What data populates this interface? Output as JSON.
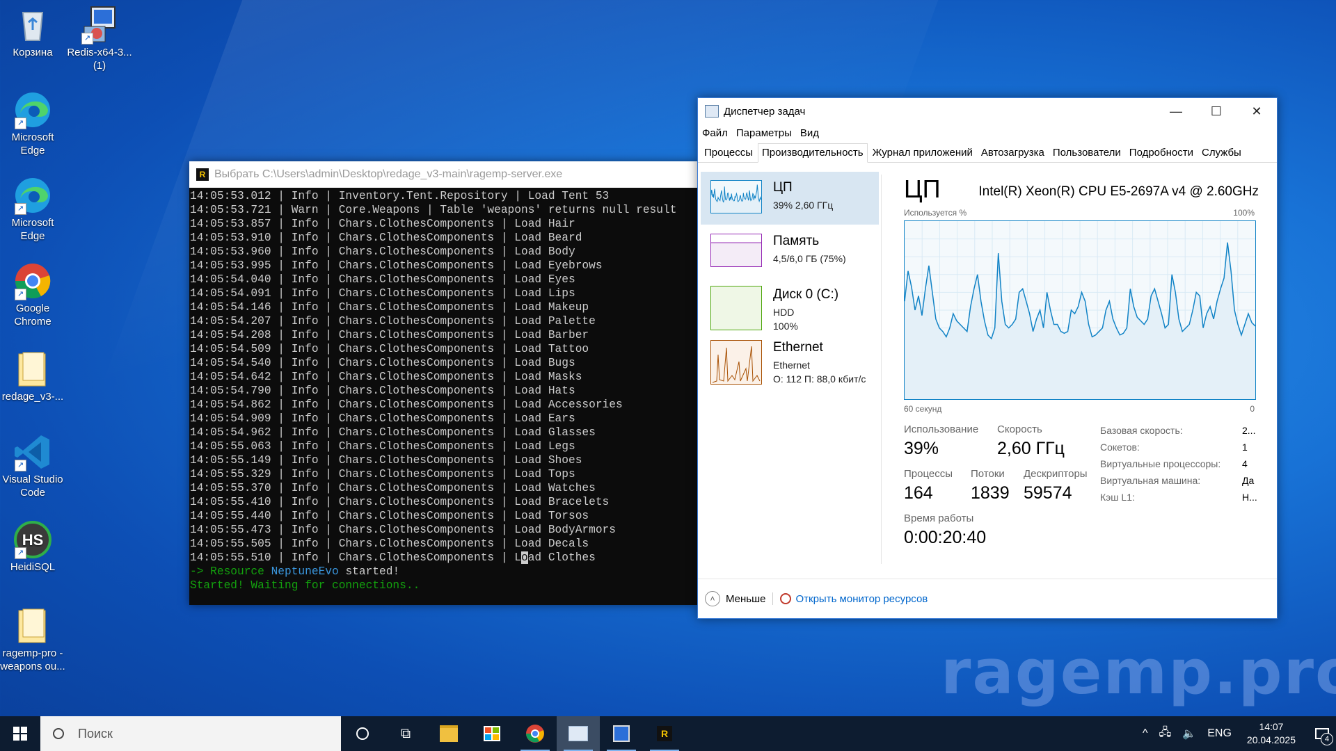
{
  "desktop": {
    "icons": [
      {
        "label": "Корзина"
      },
      {
        "label": "Redis-x64-3...(1)"
      },
      {
        "label": "Microsoft Edge"
      },
      {
        "label": "Microsoft Edge"
      },
      {
        "label": "Google Chrome"
      },
      {
        "label": "redage_v3-..."
      },
      {
        "label": "Visual Studio Code"
      },
      {
        "label": "HeidiSQL"
      },
      {
        "label": "ragemp-pro - weapons ou..."
      }
    ],
    "watermark": "ragemp.pro"
  },
  "console": {
    "title": "Выбрать C:\\Users\\admin\\Desktop\\redage_v3-main\\ragemp-server.exe",
    "lines": [
      "14:05:53.012 | Info | Inventory.Tent.Repository | Load Tent 53",
      "14:05:53.721 | Warn | Core.Weapons | Table 'weapons' returns null result",
      "14:05:53.857 | Info | Chars.ClothesComponents | Load Hair",
      "14:05:53.910 | Info | Chars.ClothesComponents | Load Beard",
      "14:05:53.960 | Info | Chars.ClothesComponents | Load Body",
      "14:05:53.995 | Info | Chars.ClothesComponents | Load Eyebrows",
      "14:05:54.040 | Info | Chars.ClothesComponents | Load Eyes",
      "14:05:54.091 | Info | Chars.ClothesComponents | Load Lips",
      "14:05:54.146 | Info | Chars.ClothesComponents | Load Makeup",
      "14:05:54.207 | Info | Chars.ClothesComponents | Load Palette",
      "14:05:54.208 | Info | Chars.ClothesComponents | Load Barber",
      "14:05:54.509 | Info | Chars.ClothesComponents | Load Tattoo",
      "14:05:54.540 | Info | Chars.ClothesComponents | Load Bugs",
      "14:05:54.642 | Info | Chars.ClothesComponents | Load Masks",
      "14:05:54.790 | Info | Chars.ClothesComponents | Load Hats",
      "14:05:54.862 | Info | Chars.ClothesComponents | Load Accessories",
      "14:05:54.909 | Info | Chars.ClothesComponents | Load Ears",
      "14:05:54.962 | Info | Chars.ClothesComponents | Load Glasses",
      "14:05:55.063 | Info | Chars.ClothesComponents | Load Legs",
      "14:05:55.149 | Info | Chars.ClothesComponents | Load Shoes",
      "14:05:55.329 | Info | Chars.ClothesComponents | Load Tops",
      "14:05:55.370 | Info | Chars.ClothesComponents | Load Watches",
      "14:05:55.410 | Info | Chars.ClothesComponents | Load Bracelets",
      "14:05:55.440 | Info | Chars.ClothesComponents | Load Torsos",
      "14:05:55.473 | Info | Chars.ClothesComponents | Load BodyArmors",
      "14:05:55.505 | Info | Chars.ClothesComponents | Load Decals"
    ],
    "last_line_prefix": "14:05:55.510 | Info | Chars.ClothesComponents | L",
    "last_line_cursor": "o",
    "last_line_suffix": "ad Clothes",
    "resource_prefix": "-> Resource ",
    "resource_name": "NeptuneEvo",
    "resource_suffix": " started!",
    "started": "Started! Waiting for connections.."
  },
  "taskmanager": {
    "title": "Диспетчер задач",
    "menu": [
      "Файл",
      "Параметры",
      "Вид"
    ],
    "tabs": [
      "Процессы",
      "Производительность",
      "Журнал приложений",
      "Автозагрузка",
      "Пользователи",
      "Подробности",
      "Службы"
    ],
    "active_tab": "Производительность",
    "side": [
      {
        "name": "ЦП",
        "sub1": "39% 2,60 ГГц",
        "sub2": "",
        "color": "#1183c6",
        "fill": "#f1f8fc"
      },
      {
        "name": "Память",
        "sub1": "4,5/6,0 ГБ (75%)",
        "sub2": "",
        "color": "#9528b4",
        "fill": "#f4ecf7"
      },
      {
        "name": "Диск 0 (C:)",
        "sub1": "HDD",
        "sub2": "100%",
        "color": "#4da60c",
        "fill": "#eff7e6"
      },
      {
        "name": "Ethernet",
        "sub1": "Ethernet",
        "sub2": "О: 112 П: 88,0 кбит/с",
        "color": "#a74f01",
        "fill": "#fbf1e8"
      }
    ],
    "cpu": {
      "heading": "ЦП",
      "model": "Intel(R) Xeon(R) CPU E5-2697A v4 @ 2.60GHz",
      "graph_label": "Используется %",
      "graph_max": "100%",
      "graph_span": "60 секунд",
      "graph_min": "0",
      "usage_history": [
        55,
        72,
        63,
        50,
        58,
        47,
        62,
        75,
        60,
        45,
        40,
        38,
        35,
        40,
        48,
        44,
        42,
        40,
        38,
        52,
        62,
        70,
        55,
        44,
        36,
        34,
        40,
        82,
        55,
        42,
        40,
        42,
        45,
        60,
        62,
        55,
        48,
        38,
        45,
        50,
        40,
        60,
        50,
        42,
        42,
        38,
        37,
        38,
        50,
        48,
        52,
        60,
        55,
        42,
        35,
        36,
        38,
        40,
        50,
        55,
        45,
        40,
        36,
        37,
        40,
        62,
        52,
        46,
        44,
        42,
        45,
        58,
        62,
        55,
        48,
        40,
        42,
        70,
        60,
        45,
        38,
        40,
        42,
        50,
        60,
        58,
        40,
        48,
        52,
        45,
        55,
        62,
        68,
        88,
        72,
        50,
        42,
        36,
        42,
        48,
        43,
        41
      ],
      "usage_label": "Использование",
      "usage_value": "39%",
      "speed_label": "Скорость",
      "speed_value": "2,60 ГГц",
      "proc_label": "Процессы",
      "proc_value": "164",
      "threads_label": "Потоки",
      "threads_value": "1839",
      "handles_label": "Дескрипторы",
      "handles_value": "59574",
      "uptime_label": "Время работы",
      "uptime_value": "0:00:20:40",
      "kv": [
        {
          "k": "Базовая скорость:",
          "v": "2..."
        },
        {
          "k": "Сокетов:",
          "v": "1"
        },
        {
          "k": "Виртуальные процессоры:",
          "v": "4"
        },
        {
          "k": "Виртуальная машина:",
          "v": "Да"
        },
        {
          "k": "Кэш L1:",
          "v": "Н..."
        }
      ]
    },
    "footer": {
      "less": "Меньше",
      "monitor": "Открыть монитор ресурсов"
    }
  },
  "taskbar": {
    "search_placeholder": "Поиск",
    "lang": "ENG",
    "time": "14:07",
    "date": "20.04.2025",
    "notifications": "4"
  }
}
